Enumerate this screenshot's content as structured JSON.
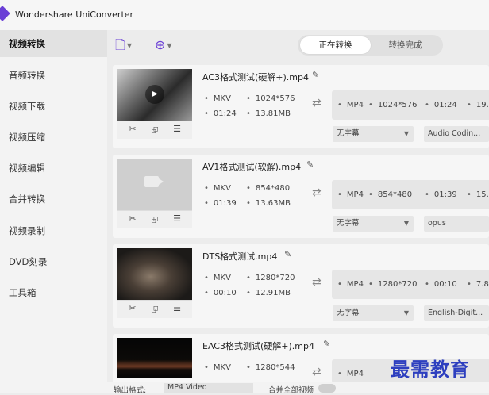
{
  "app": {
    "title": "Wondershare UniConverter"
  },
  "sidebar": {
    "items": [
      {
        "label": "视频转换"
      },
      {
        "label": "音频转换"
      },
      {
        "label": "视频下载"
      },
      {
        "label": "视频压缩"
      },
      {
        "label": "视频编辑"
      },
      {
        "label": "合并转换"
      },
      {
        "label": "视频录制"
      },
      {
        "label": "DVD刻录"
      },
      {
        "label": "工具箱"
      }
    ],
    "active_index": 0
  },
  "toolbar": {
    "icons": [
      "add-file-icon",
      "add-disc-icon"
    ],
    "tabs": [
      {
        "label": "正在转换"
      },
      {
        "label": "转换完成"
      }
    ],
    "active_tab": 0
  },
  "files": [
    {
      "name": "AC3格式测试(硬解+).mp4",
      "src_format": "MKV",
      "src_resolution": "1024*576",
      "src_duration": "01:24",
      "src_size": "13.81MB",
      "out_format": "MP4",
      "out_resolution": "1024*576",
      "out_duration": "01:24",
      "out_size_partial": "19.",
      "subtitle": "无字幕",
      "audio": "Audio Codin..."
    },
    {
      "name": "AV1格式测试(软解).mp4",
      "src_format": "MKV",
      "src_resolution": "854*480",
      "src_duration": "01:39",
      "src_size": "13.63MB",
      "out_format": "MP4",
      "out_resolution": "854*480",
      "out_duration": "01:39",
      "out_size_partial": "15.",
      "subtitle": "无字幕",
      "audio": "opus"
    },
    {
      "name": "DTS格式测试.mp4",
      "src_format": "MKV",
      "src_resolution": "1280*720",
      "src_duration": "00:10",
      "src_size": "12.91MB",
      "out_format": "MP4",
      "out_resolution": "1280*720",
      "out_duration": "00:10",
      "out_size_partial": "7.8",
      "subtitle": "无字幕",
      "audio": "English-Digit..."
    },
    {
      "name": "EAC3格式测试(硬解+).mp4",
      "src_format": "MKV",
      "src_resolution": "1280*544",
      "out_format": "MP4"
    }
  ],
  "bottom": {
    "output_format_label": "输出格式:",
    "output_format_value": "MP4 Video",
    "merge_label": "合并全部视频"
  },
  "watermark": "最需教育",
  "colors": {
    "accent": "#6a3fd6",
    "watermark": "#2d3fbf"
  }
}
